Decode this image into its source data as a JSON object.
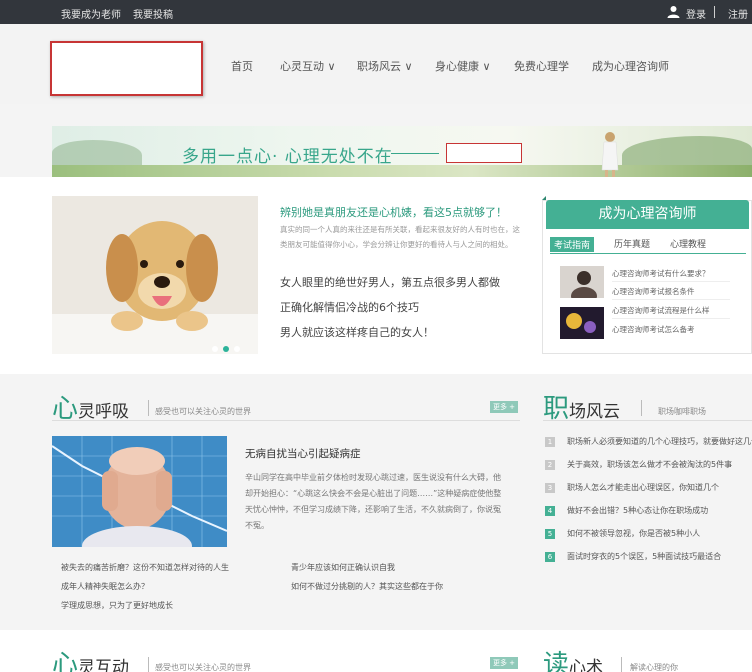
{
  "topbar": {
    "left_links": [
      "我要成为老师",
      "我要投稿"
    ],
    "login": "登录",
    "separator": "|",
    "register": "注册"
  },
  "nav": {
    "items": [
      {
        "label": "首页"
      },
      {
        "label": "心灵互动 ∨"
      },
      {
        "label": "职场风云 ∨"
      },
      {
        "label": "身心健康 ∨"
      },
      {
        "label": "免费心理学"
      },
      {
        "label": "成为心理咨询师"
      }
    ]
  },
  "banner": {
    "slogan": "多用一点心· 心理无处不在"
  },
  "featured": {
    "title": "辨别她是真朋友还是心机婊，看这5点就够了！",
    "desc": "真实的同一个人真的来往还是有所关联，看起来很友好的人有时也在，这类朋友可能值得你小心，学会分辨让你更好的看待人与人之间的相处。",
    "items": [
      "女人眼里的绝世好男人，第五点很多男人都做",
      "正确化解情侣冷战的6个技巧",
      "男人就应该这样疼自己的女人！"
    ]
  },
  "sidebar": {
    "button": "成为心理咨询师",
    "tabs": [
      "考试指南",
      "历年真题",
      "心理教程"
    ],
    "questions": [
      "心理咨询师考试有什么要求？",
      "心理咨询师考试报名条件",
      "心理咨询师考试流程是什么样",
      "心理咨询师考试怎么备考"
    ]
  },
  "section1": {
    "title_big": "心",
    "title_rest": "灵呼吸",
    "subtitle": "感受也可以关注心灵的世界",
    "more": "更多 +",
    "article_title": "无病自扰当心引起疑病症",
    "article_desc": "辛山同学在高中毕业前夕体检时发现心跳过速，医生说没有什么大碍，他却开始担心：“心跳这么快会不会是心脏出了问题……”这种疑病症使他整天忧心忡忡，不但学习成绩下降，还影响了生活，不久就病倒了，你说冤不冤。",
    "links": [
      "被失去的痛苦折磨？这份不知道怎样对待的人生",
      "青少年应该如何正确认识自我",
      "成年人精神失眠怎么办？",
      "如何不做过分挑剔的人？其实这些都在于你",
      "学理成思想，只为了更好地成长"
    ]
  },
  "section2": {
    "title_big": "职",
    "title_rest": "场风云",
    "subtitle": "职场咖啡职场",
    "ranks": [
      {
        "num": "1",
        "text": "职场新人必须要知道的几个心理技巧，就要做好这几个"
      },
      {
        "num": "2",
        "text": "关于高效，职场该怎么做才不会被淘汰的5件事"
      },
      {
        "num": "3",
        "text": "职场人怎么才能走出心理误区，你知道几个"
      },
      {
        "num": "4",
        "text": "做好不会出错？5种心态让你在职场成功"
      },
      {
        "num": "5",
        "text": "如何不被领导忽视，你是否被5种小人"
      },
      {
        "num": "6",
        "text": "面试时穿衣的5个误区，5种面试技巧最适合"
      }
    ]
  },
  "section3": {
    "title_big": "心",
    "title_rest": "灵互动",
    "subtitle": "感受也可以关注心灵的世界",
    "more": "更多 +"
  },
  "section4": {
    "title_big": "读",
    "title_rest": "心术",
    "subtitle": "解读心理的你"
  }
}
